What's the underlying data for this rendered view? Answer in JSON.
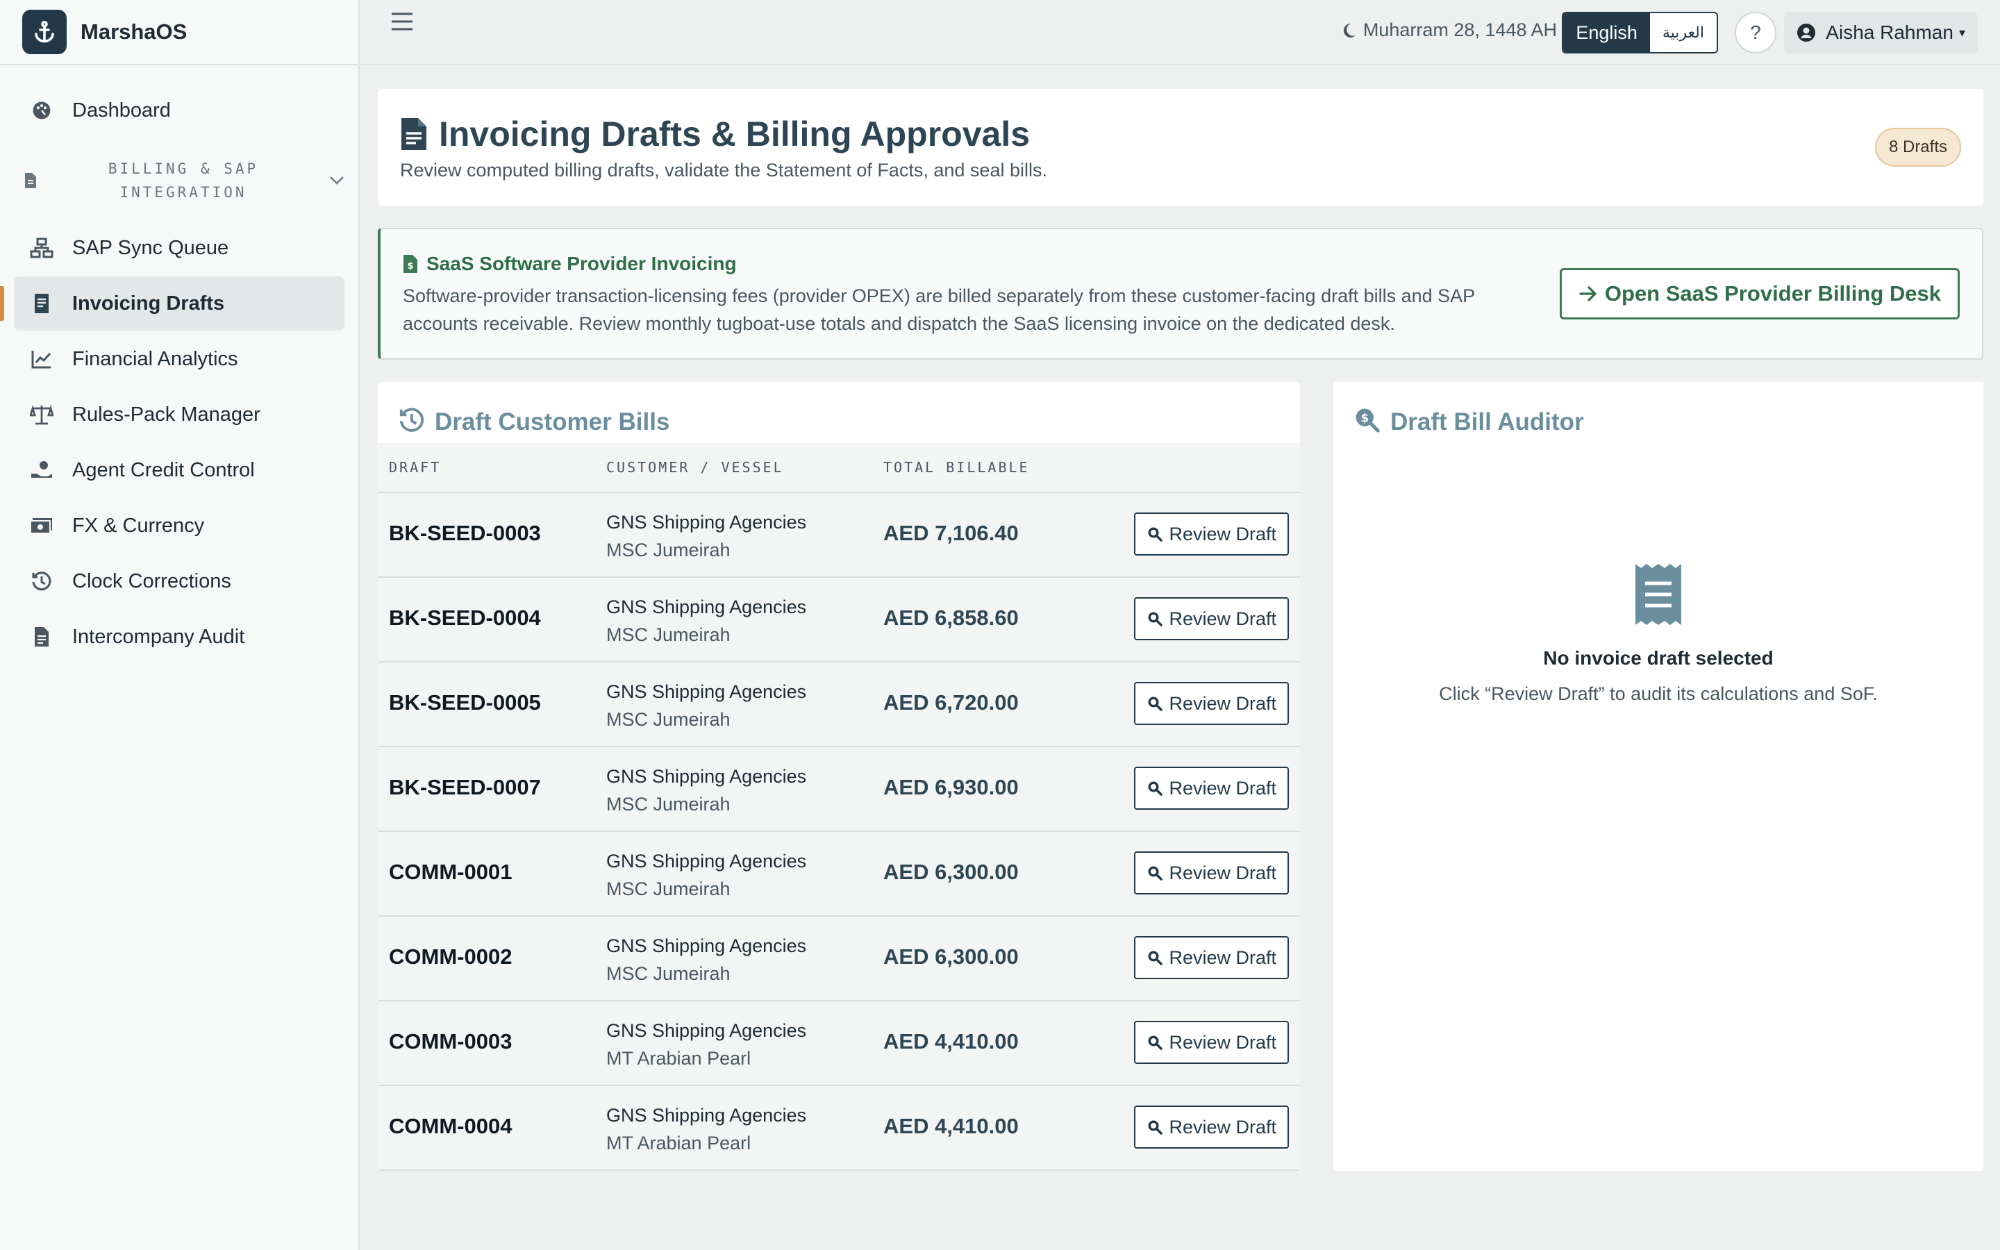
{
  "app": {
    "name": "MarshaOS"
  },
  "sidebar": {
    "items_top": [
      {
        "label": "Dashboard",
        "icon": "palette-icon"
      }
    ],
    "group": {
      "label": "BILLING & SAP INTEGRATION",
      "icon": "file-icon"
    },
    "items": [
      {
        "label": "SAP Sync Queue",
        "icon": "sitemap-icon"
      },
      {
        "label": "Invoicing Drafts",
        "icon": "file-invoice-icon"
      },
      {
        "label": "Financial Analytics",
        "icon": "line-chart-icon"
      },
      {
        "label": "Rules-Pack Manager",
        "icon": "scale-icon"
      },
      {
        "label": "Agent Credit Control",
        "icon": "hand-coin-icon"
      },
      {
        "label": "FX & Currency",
        "icon": "money-icon"
      },
      {
        "label": "Clock Corrections",
        "icon": "history-icon"
      },
      {
        "label": "Intercompany Audit",
        "icon": "document-icon"
      }
    ]
  },
  "topbar": {
    "hijri_date": "Muharram 28, 1448 AH",
    "lang_en": "English",
    "lang_ar": "العربية",
    "help": "?",
    "user_name": "Aisha Rahman"
  },
  "header": {
    "title": "Invoicing Drafts & Billing Approvals",
    "subtitle": "Review computed billing drafts, validate the Statement of Facts, and seal bills.",
    "badge": "8 Drafts"
  },
  "saas": {
    "title": "SaaS Software Provider Invoicing",
    "text": "Software-provider transaction-licensing fees (provider OPEX) are billed separately from these customer-facing draft bills and SAP accounts receivable. Review monthly tugboat-use totals and dispatch the SaaS licensing invoice on the dedicated desk.",
    "button": "Open SaaS Provider Billing Desk"
  },
  "bills": {
    "title": "Draft Customer Bills",
    "columns": {
      "draft": "DRAFT",
      "customer": "CUSTOMER / VESSEL",
      "total": "TOTAL BILLABLE"
    },
    "review_label": "Review Draft",
    "rows": [
      {
        "draft": "BK-SEED-0003",
        "customer": "GNS Shipping Agencies",
        "vessel": "MSC Jumeirah",
        "total": "AED 7,106.40"
      },
      {
        "draft": "BK-SEED-0004",
        "customer": "GNS Shipping Agencies",
        "vessel": "MSC Jumeirah",
        "total": "AED 6,858.60"
      },
      {
        "draft": "BK-SEED-0005",
        "customer": "GNS Shipping Agencies",
        "vessel": "MSC Jumeirah",
        "total": "AED 6,720.00"
      },
      {
        "draft": "BK-SEED-0007",
        "customer": "GNS Shipping Agencies",
        "vessel": "MSC Jumeirah",
        "total": "AED 6,930.00"
      },
      {
        "draft": "COMM-0001",
        "customer": "GNS Shipping Agencies",
        "vessel": "MSC Jumeirah",
        "total": "AED 6,300.00"
      },
      {
        "draft": "COMM-0002",
        "customer": "GNS Shipping Agencies",
        "vessel": "MSC Jumeirah",
        "total": "AED 6,300.00"
      },
      {
        "draft": "COMM-0003",
        "customer": "GNS Shipping Agencies",
        "vessel": "MT Arabian Pearl",
        "total": "AED 4,410.00"
      },
      {
        "draft": "COMM-0004",
        "customer": "GNS Shipping Agencies",
        "vessel": "MT Arabian Pearl",
        "total": "AED 4,410.00"
      }
    ]
  },
  "auditor": {
    "title": "Draft Bill Auditor",
    "empty_title": "No invoice draft selected",
    "empty_text": "Click “Review Draft” to audit its calculations and SoF."
  },
  "colors": {
    "brand": "#23394a",
    "accent": "#d98a3c",
    "success": "#3d7a56",
    "muted_heading": "#6a8e9e"
  }
}
